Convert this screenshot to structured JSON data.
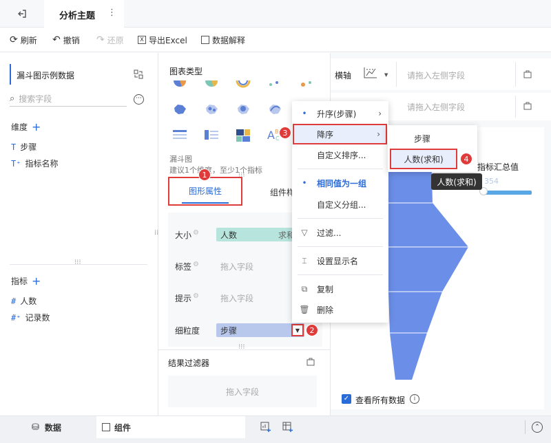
{
  "topbar": {
    "title": "分析主题",
    "more": "⋮"
  },
  "toolbar": {
    "refresh": "刷新",
    "undo": "撤销",
    "redo": "还原",
    "export": "导出Excel",
    "explain": "数据解释"
  },
  "left": {
    "dataset": "漏斗图示例数据",
    "search_placeholder": "搜索字段",
    "dimension_title": "维度",
    "dimensions": [
      "步骤",
      "指标名称"
    ],
    "measure_title": "指标",
    "measures": [
      "人数",
      "记录数"
    ]
  },
  "mid": {
    "chart_type_title": "图表类型",
    "chart_name": "漏斗图",
    "chart_hint": "建议1个维度，至少1个指标",
    "tab_graph": "图形属性",
    "tab_component": "组件样式",
    "props": {
      "size_label": "大小",
      "size_value": "人数",
      "size_agg": "求和",
      "label_label": "标签",
      "label_placeholder": "拖入字段",
      "tip_label": "提示",
      "tip_placeholder": "拖入字段",
      "grain_label": "细粒度",
      "grain_value": "步骤"
    },
    "filter_title": "结果过滤器",
    "filter_placeholder": "拖入字段"
  },
  "right": {
    "xaxis_label": "横轴",
    "xaxis_placeholder": "请拖入左侧字段",
    "yaxis_placeholder": "请拖入左侧字段",
    "summary_label": "指标汇总值",
    "summary_value": "354",
    "view_all": "查看所有数据"
  },
  "menu": {
    "asc": "升序(步骤)",
    "desc": "降序",
    "custom_sort": "自定义排序...",
    "same_group": "相同值为一组",
    "custom_group": "自定义分组...",
    "filter": "过滤...",
    "display_name": "设置显示名",
    "copy": "复制",
    "delete": "删除"
  },
  "submenu": {
    "step": "步骤",
    "people_sum": "人数(求和)"
  },
  "tooltip": "人数(求和)",
  "badges": [
    "1",
    "2",
    "3",
    "4"
  ],
  "bottom": {
    "data_tab": "数据",
    "component_tab": "组件"
  },
  "colors": {
    "accent": "#2b6bd8",
    "funnel": "#6b8ee8",
    "red": "#e03b3b",
    "teal_pill": "#b7e4dd",
    "blue_pill": "#b7c8ec"
  }
}
